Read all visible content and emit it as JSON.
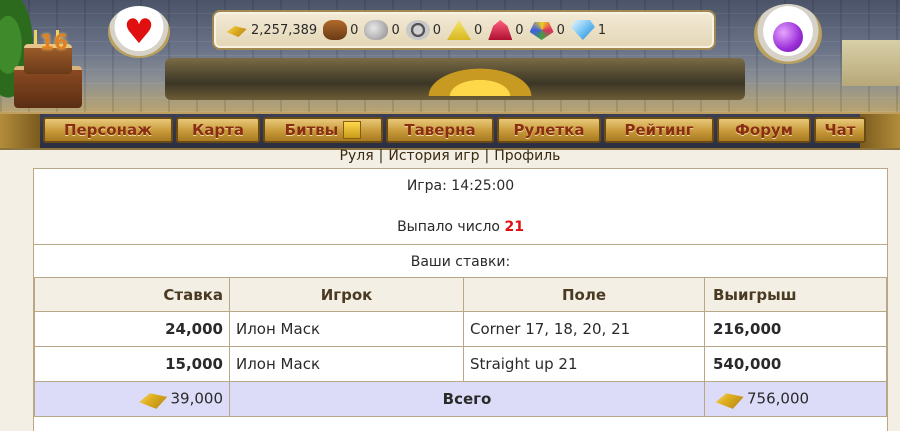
{
  "header": {
    "level_badge": "16",
    "resources": [
      {
        "icon": "gold-icon",
        "value": "2,257,389"
      },
      {
        "icon": "wood-icon",
        "value": "0"
      },
      {
        "icon": "stone-icon",
        "value": "0"
      },
      {
        "icon": "iron-icon",
        "value": "0"
      },
      {
        "icon": "sulfur-icon",
        "value": "0"
      },
      {
        "icon": "crystal-icon",
        "value": "0"
      },
      {
        "icon": "gems-icon",
        "value": "0"
      },
      {
        "icon": "diamond-icon",
        "value": "1"
      }
    ]
  },
  "nav": {
    "character": "Персонаж",
    "map": "Карта",
    "battles": "Битвы",
    "tavern": "Таверна",
    "roulette": "Рулетка",
    "rating": "Рейтинг",
    "forum": "Форум",
    "chat": "Чат"
  },
  "sublinks": {
    "roulette": "Руля",
    "history": "История игр",
    "profile": "Профиль",
    "separator": "|"
  },
  "game": {
    "time_label": "Игра: 14:25:00",
    "drawn_label": "Выпало число",
    "drawn_number": "21",
    "your_bets": "Ваши ставки:"
  },
  "table": {
    "headers": {
      "stake": "Ставка",
      "player": "Игрок",
      "field": "Поле",
      "win": "Выигрыш"
    },
    "rows": [
      {
        "stake": "24,000",
        "player": "Илон Маск",
        "field": "Corner 17, 18, 20, 21",
        "win": "216,000"
      },
      {
        "stake": "15,000",
        "player": "Илон Маск",
        "field": "Straight up 21",
        "win": "540,000"
      }
    ],
    "total": {
      "stake": "39,000",
      "label": "Всего",
      "win": "756,000"
    }
  },
  "colors": {
    "nav_text": "#8a2e12",
    "drawn_number": "#e01010",
    "total_row_bg": "#dcdcf8"
  }
}
